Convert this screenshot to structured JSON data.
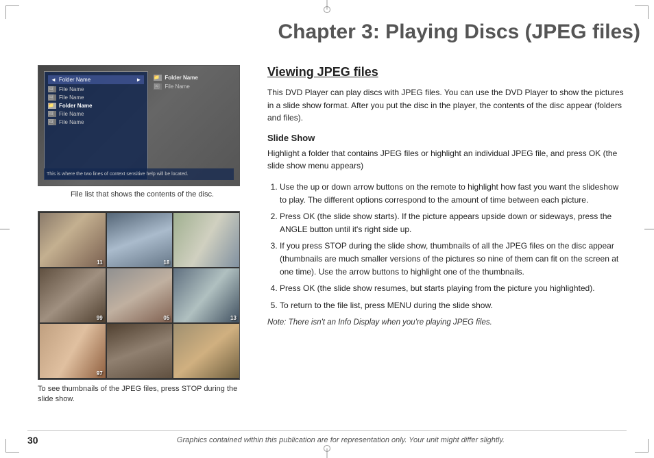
{
  "page": {
    "chapter_heading": "Chapter 3: Playing Discs (JPEG files)",
    "section_title": "Viewing JPEG files",
    "intro_text": "This DVD Player can play discs with JPEG files. You can use the DVD Player to show the pictures in a slide show format. After you put the disc in the player, the contents of the disc appear (folders and files).",
    "slide_show_title": "Slide Show",
    "slide_show_intro": "Highlight a folder that contains JPEG files or highlight an individual JPEG file, and press OK (the slide show menu appears)",
    "steps": [
      "Use the up or down arrow buttons on the remote to highlight how fast you want the slideshow to play. The different options correspond to the amount of time between each picture.",
      "Press OK (the slide show starts). If the picture appears upside down or sideways, press the ANGLE button until it's right side up.",
      "If you press STOP during the slide show, thumbnails of all the JPEG files on the disc appear (thumbnails are much smaller versions of the pictures so nine of them can fit on the screen at one time). Use the arrow buttons to highlight one of the thumbnails.",
      "Press OK (the slide show resumes, but starts playing from the picture you highlighted).",
      "To return to the file list, press MENU during the slide show."
    ],
    "note_text": "Note: There isn't an Info Display when you're playing JPEG files.",
    "file_list_caption": "File list that shows the contents of the disc.",
    "thumbnail_caption": "To see thumbnails of the JPEG files, press STOP during the slide show.",
    "file_list_items_left": [
      {
        "type": "folder",
        "label": "Folder Name"
      },
      {
        "type": "file",
        "label": "File Name"
      },
      {
        "type": "file",
        "label": "File Name"
      },
      {
        "type": "folder",
        "label": "Folder Name"
      },
      {
        "type": "file",
        "label": "File Name"
      },
      {
        "type": "file",
        "label": "File Name"
      }
    ],
    "file_list_items_right": [
      {
        "type": "folder",
        "label": "Folder Name"
      },
      {
        "type": "file",
        "label": "File Name"
      }
    ],
    "help_text": "This is where the two lines of context sensitive help will be located.",
    "thumb_numbers": [
      "11",
      "18",
      "",
      "99",
      "05",
      "13",
      "97",
      "",
      ""
    ],
    "footer_page": "30",
    "footer_text": "Graphics contained within this publication are for representation only. Your unit might differ slightly."
  }
}
